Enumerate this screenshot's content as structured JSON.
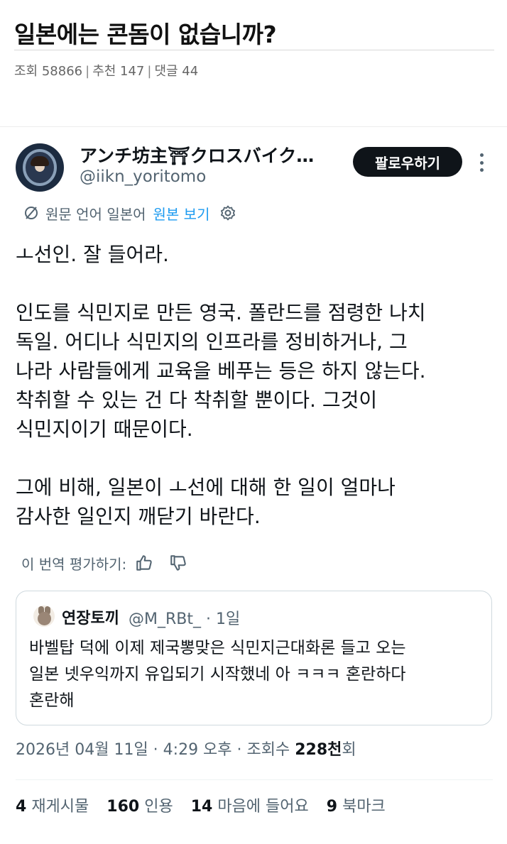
{
  "post": {
    "title": "일본에는 콘돔이 없습니까?",
    "views_label": "조회 58866",
    "recommend_label": "추천 147",
    "comments_label": "댓글 44",
    "separator": "|"
  },
  "tweet": {
    "display_name": "アンチ坊主⛩クロスバイク…",
    "handle": "@iikn_yoritomo",
    "follow_label": "팔로우하기",
    "translate_info": "원문 언어 일본어",
    "view_original": "원본 보기",
    "body_lines": [
      "ㅗ선인. 잘 들어라.",
      "",
      "인도를 식민지로 만든 영국. 폴란드를 점령한 나치",
      "독일. 어디나 식민지의 인프라를 정비하거나, 그",
      "나라 사람들에게 교육을 베푸는 등은 하지 않는다.",
      "착취할 수 있는 건 다 착취할 뿐이다. 그것이",
      "식민지이기 때문이다.",
      "",
      "그에 비해, 일본이 ㅗ선에 대해 한 일이 얼마나",
      "감사한 일인지 깨닫기 바란다."
    ],
    "rate_label": "이 번역 평가하기:",
    "quote": {
      "name": "연장토끼",
      "handle": "@M_RBt_ · 1일",
      "body_lines": [
        "바벨탑 덕에 이제 제국뽕맞은 식민지근대화론 들고 오는",
        "일본 넷우익까지 유입되기 시작했네 아 ㅋㅋㅋ 혼란하다",
        "혼란해"
      ]
    },
    "timestamp_prefix": "2026년 04월 11일 · 4:29 오후 · 조회수 ",
    "views_number": "228천",
    "views_suffix": "회",
    "stats": {
      "reposts_count": "4",
      "reposts_label": "재게시물",
      "quotes_count": "160",
      "quotes_label": "인용",
      "likes_count": "14",
      "likes_label": "마음에 들어요",
      "bookmarks_count": "9",
      "bookmarks_label": "북마크"
    }
  },
  "colors": {
    "accent": "#1d9bf0",
    "text_primary": "#0f1419",
    "text_secondary": "#536471",
    "button_bg": "#0f1419"
  },
  "icons": [
    "translate-globe-icon",
    "settings-gear-icon",
    "thumbs-up-icon",
    "thumbs-down-icon",
    "more-options-icon"
  ]
}
